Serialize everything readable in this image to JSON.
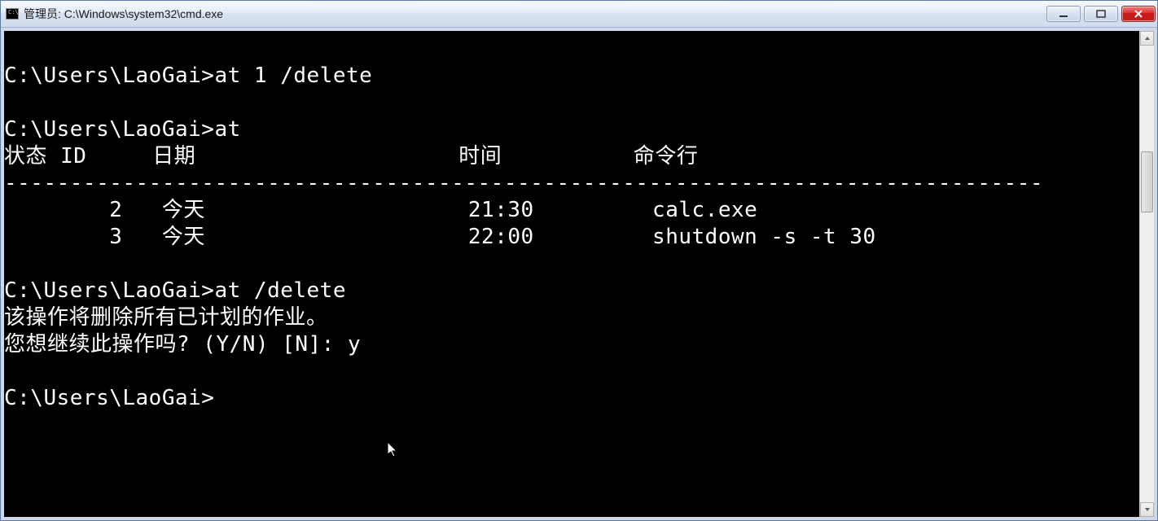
{
  "window": {
    "title": "管理员: C:\\Windows\\system32\\cmd.exe",
    "icon_text": "C:\\"
  },
  "terminal": {
    "lines": [
      "",
      "C:\\Users\\LaoGai>at 1 /delete",
      "",
      "C:\\Users\\LaoGai>at",
      "状态 ID     日期                    时间          命令行",
      "-------------------------------------------------------------------------------",
      "        2   今天                    21:30         calc.exe",
      "        3   今天                    22:00         shutdown -s -t 30",
      "",
      "C:\\Users\\LaoGai>at /delete",
      "该操作将删除所有已计划的作业。",
      "您想继续此操作吗? (Y/N) [N]: y",
      "",
      "C:\\Users\\LaoGai>"
    ]
  }
}
